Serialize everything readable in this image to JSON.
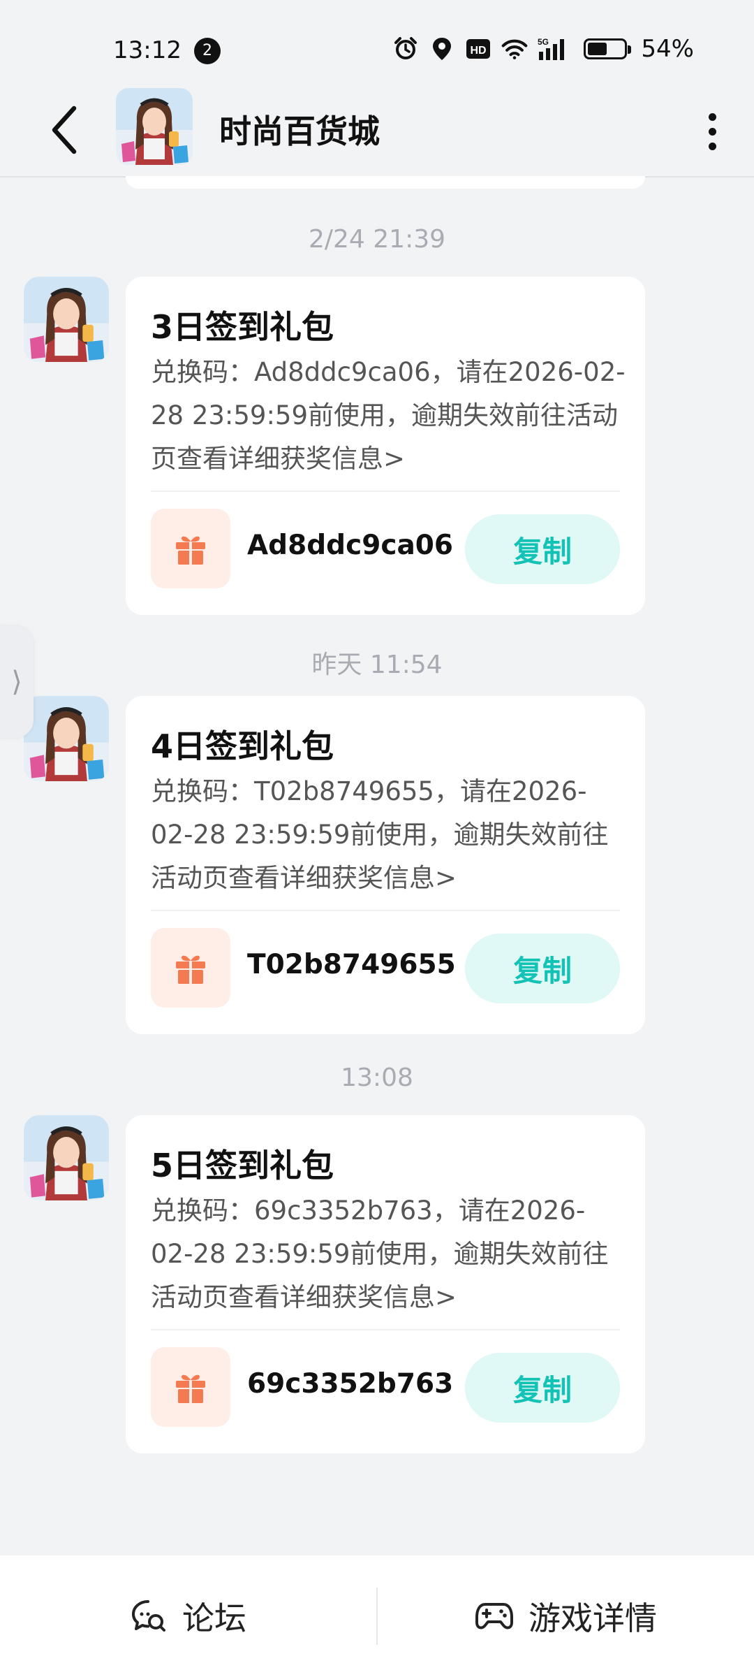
{
  "status_bar": {
    "time": "13:12",
    "notification_count": "2",
    "battery": "54%",
    "battery_level": 0.54,
    "icons": [
      "alarm-icon",
      "location-icon",
      "hd-icon",
      "wifi-icon",
      "5g-signal-icon",
      "battery-icon"
    ]
  },
  "header": {
    "title": "时尚百货城"
  },
  "messages": [
    {
      "timestamp": "2/24  21:39",
      "title": "3日签到礼包",
      "body": "兑换码：Ad8ddc9ca06，请在2026-02-28 23:59:59前使用，逾期失效前往活动页查看详细获奖信息>",
      "code": "Ad8ddc9ca06",
      "copy_label": "复制"
    },
    {
      "timestamp": "昨天  11:54",
      "title": "4日签到礼包",
      "body": "兑换码：T02b8749655，请在2026-02-28 23:59:59前使用，逾期失效前往活动页查看详细获奖信息>",
      "code": "T02b8749655",
      "copy_label": "复制"
    },
    {
      "timestamp": "13:08",
      "title": "5日签到礼包",
      "body": "兑换码：69c3352b763，请在2026-02-28 23:59:59前使用，逾期失效前往活动页查看详细获奖信息>",
      "code": "69c3352b763",
      "copy_label": "复制"
    }
  ],
  "side_handle": "⟩",
  "bottom_nav": {
    "forum_label": "论坛",
    "game_details_label": "游戏详情"
  },
  "colors": {
    "accent": "#12c2b4",
    "copy_bg": "#e0f8f6",
    "gift": "#f47a52",
    "gift_bg": "#ffeee8",
    "page_bg": "#f2f3f5"
  }
}
